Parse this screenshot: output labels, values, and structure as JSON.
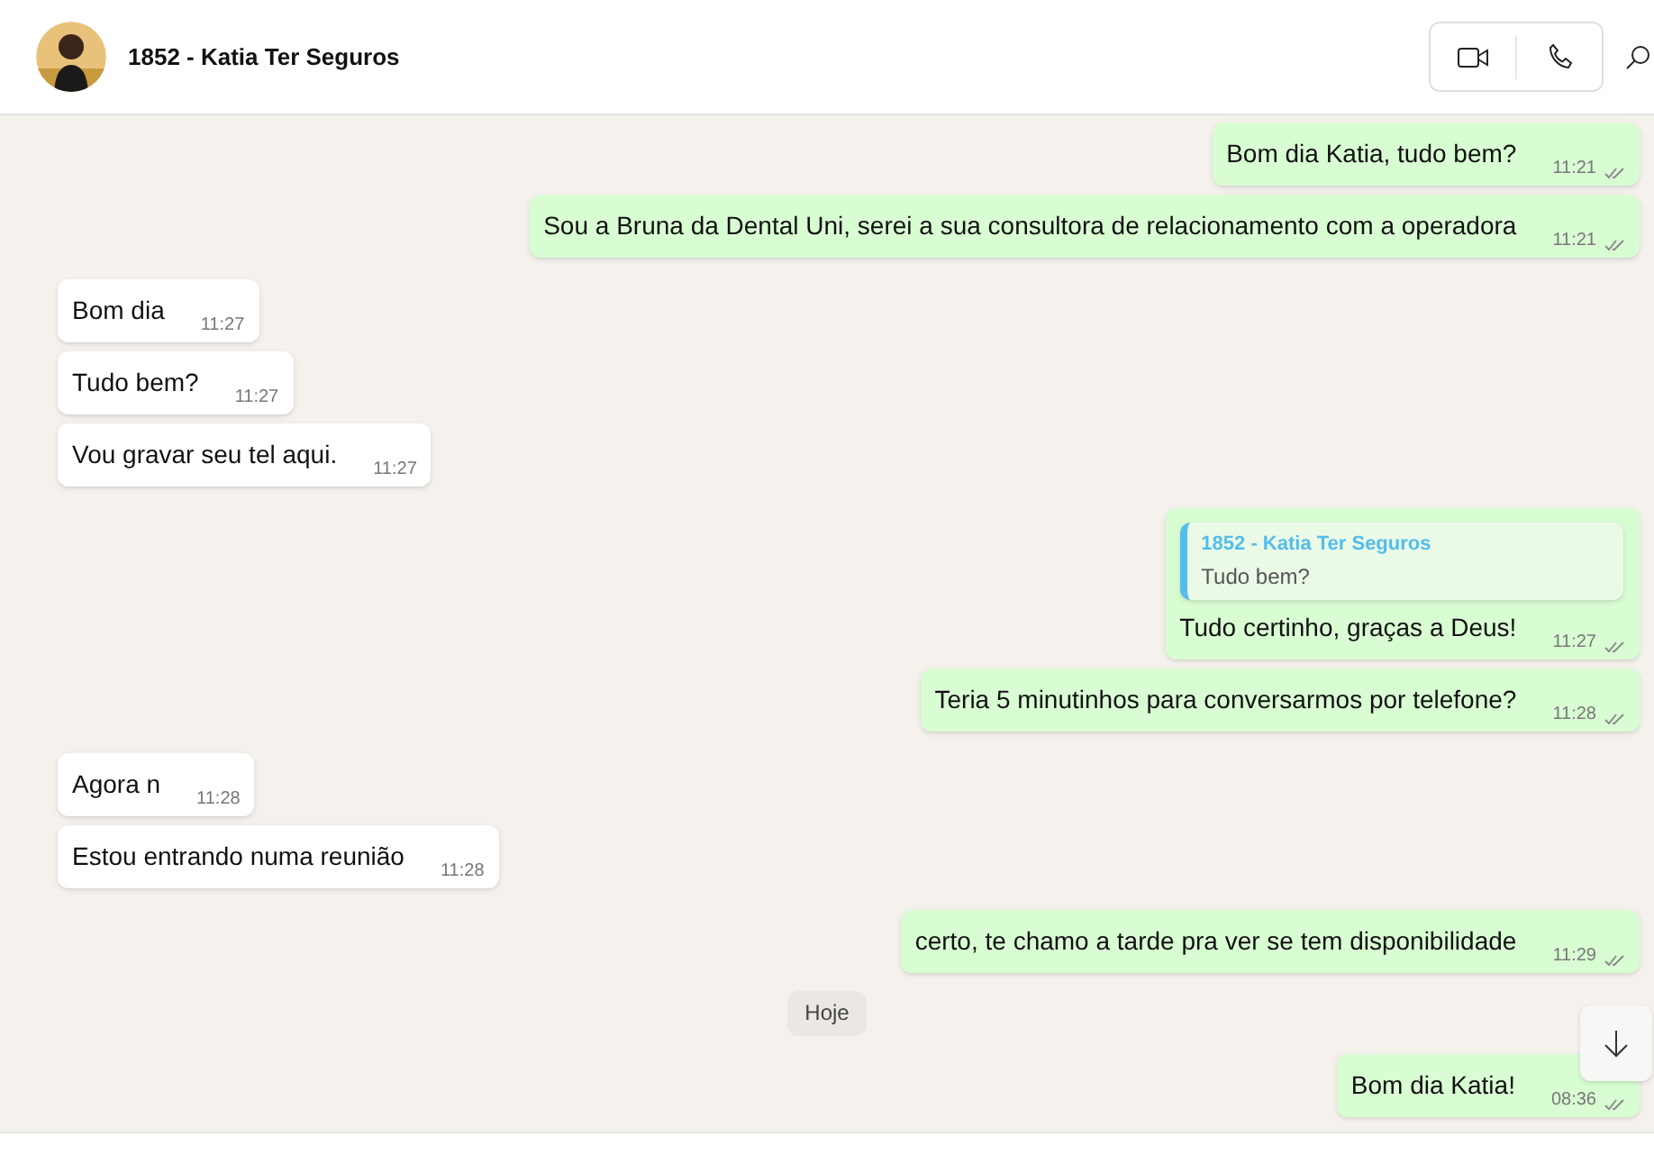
{
  "header": {
    "title": "1852 - Katia Ter Seguros"
  },
  "messages": [
    {
      "kind": "out",
      "text": "Bom dia Katia, tudo bem?",
      "time": "11:21"
    },
    {
      "kind": "out",
      "text": "Sou a Bruna da Dental Uni, serei a sua consultora de relacionamento com a operadora",
      "time": "11:21"
    },
    {
      "kind": "in",
      "text": "Bom dia",
      "time": "11:27"
    },
    {
      "kind": "in",
      "text": "Tudo bem?",
      "time": "11:27"
    },
    {
      "kind": "in",
      "text": "Vou gravar seu tel aqui.",
      "time": "11:27"
    },
    {
      "kind": "out",
      "text": "Tudo certinho, graças a Deus!",
      "time": "11:27",
      "quote": {
        "author": "1852 - Katia Ter Seguros",
        "text": "Tudo bem?"
      }
    },
    {
      "kind": "out",
      "text": "Teria 5 minutinhos para conversarmos por telefone?",
      "time": "11:28"
    },
    {
      "kind": "in",
      "text": "Agora n",
      "time": "11:28"
    },
    {
      "kind": "in",
      "text": "Estou entrando numa reunião",
      "time": "11:28"
    },
    {
      "kind": "out",
      "text": "certo, te chamo a tarde pra ver se tem disponibilidade",
      "time": "11:29"
    },
    {
      "kind": "date",
      "text": "Hoje"
    },
    {
      "kind": "out",
      "text": "Bom dia Katia!",
      "time": "08:36"
    }
  ]
}
